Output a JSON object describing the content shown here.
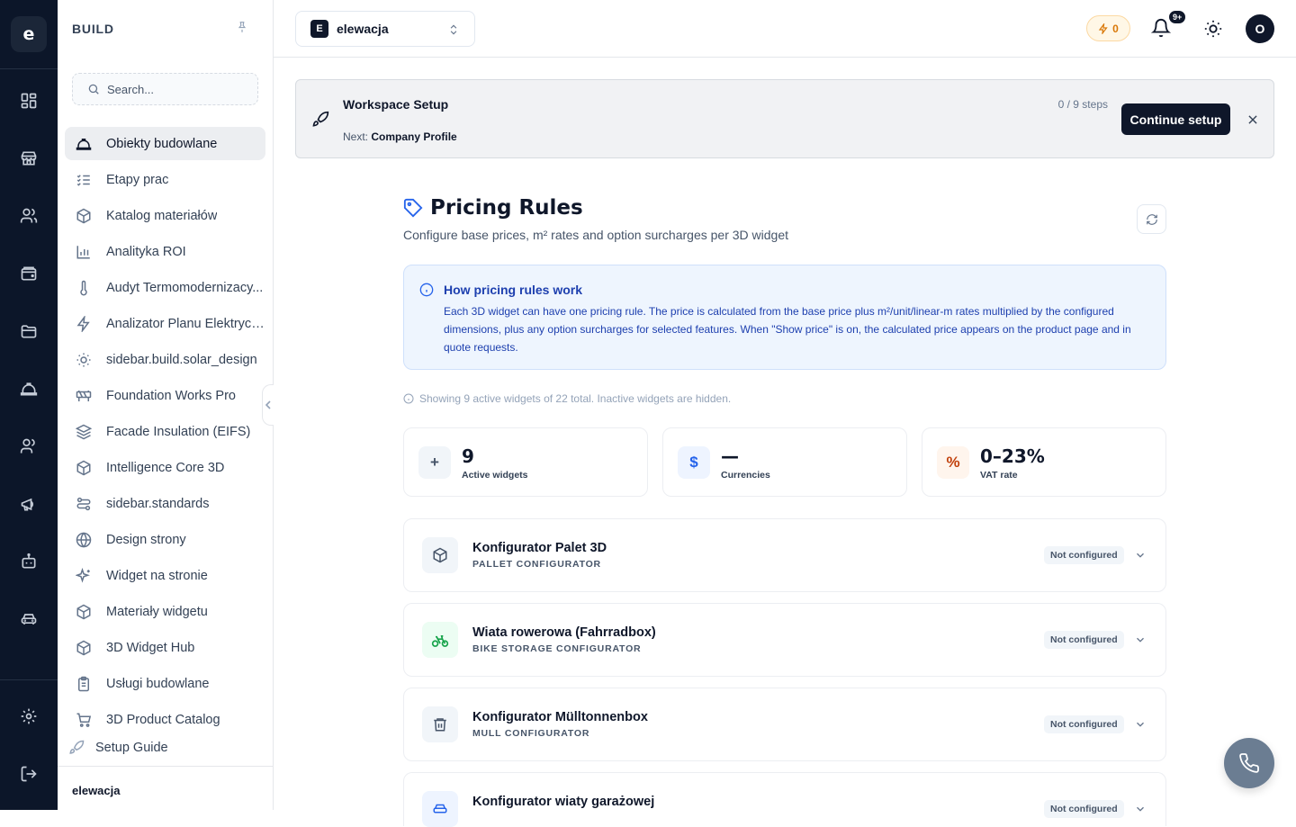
{
  "rail": {
    "logo_letter": "e",
    "icons": [
      "dashboard-icon",
      "store-icon",
      "users-icon",
      "wallet-icon",
      "folder-icon",
      "helmet-icon",
      "team-icon",
      "megaphone-icon",
      "robot-icon",
      "car-icon"
    ],
    "bottom_icons": [
      "settings-icon",
      "logout-icon"
    ]
  },
  "sidebar": {
    "section": "BUILD",
    "search_placeholder": "Search...",
    "items": [
      {
        "label": "Obiekty budowlane",
        "icon": "helmet-icon",
        "active": true
      },
      {
        "label": "Etapy prac",
        "icon": "checklist-icon"
      },
      {
        "label": "Katalog materiałów",
        "icon": "box-icon"
      },
      {
        "label": "Analityka ROI",
        "icon": "bar-chart-icon"
      },
      {
        "label": "Audyt Termomodernizacy...",
        "icon": "thermometer-icon"
      },
      {
        "label": "Analizator Planu Elektrycz...",
        "icon": "lightning-icon"
      },
      {
        "label": "sidebar.build.solar_design",
        "icon": "sun-icon"
      },
      {
        "label": "Foundation Works Pro",
        "icon": "barrier-icon"
      },
      {
        "label": "Facade Insulation (EIFS)",
        "icon": "layers-icon"
      },
      {
        "label": "Intelligence Core 3D",
        "icon": "box-icon"
      },
      {
        "label": "sidebar.standards",
        "icon": "route-icon"
      },
      {
        "label": "Design strony",
        "icon": "globe-icon"
      },
      {
        "label": "Widget na stronie",
        "icon": "sparkles-icon"
      },
      {
        "label": "Materiały widgetu",
        "icon": "box-icon"
      },
      {
        "label": "3D Widget Hub",
        "icon": "box-icon"
      },
      {
        "label": "Usługi budowlane",
        "icon": "clipboard-icon"
      },
      {
        "label": "3D Product Catalog",
        "icon": "cart-icon"
      }
    ],
    "setup_guide": "Setup Guide",
    "footer_workspace": "elewacja"
  },
  "topbar": {
    "workspace_letter": "E",
    "workspace_name": "elewacja",
    "credits": "0",
    "notifications_badge": "9+",
    "avatar_letter": "O"
  },
  "banner": {
    "title": "Workspace Setup",
    "next_label": "Next:",
    "next_value": "Company Profile",
    "steps": "0 / 9 steps",
    "button": "Continue setup"
  },
  "page": {
    "title": "Pricing Rules",
    "subtitle": "Configure base prices, m² rates and option surcharges per 3D widget",
    "info_title": "How pricing rules work",
    "info_body": "Each 3D widget can have one pricing rule. The price is calculated from the base price plus m²/unit/linear-m rates multiplied by the configured dimensions, plus any option surcharges for selected features. When \"Show price\" is on, the calculated price appears on the product page and in quote requests.",
    "note": "Showing 9 active widgets of 22 total. Inactive widgets are hidden."
  },
  "stats": [
    {
      "value": "9",
      "label": "Active widgets",
      "glyph": "+",
      "color": "#475569",
      "bg": "#f1f5f9"
    },
    {
      "value": "—",
      "label": "Currencies",
      "glyph": "$",
      "color": "#2563eb",
      "bg": "#eef4ff"
    },
    {
      "value": "0–23%",
      "label": "VAT rate",
      "glyph": "%",
      "color": "#c2410c",
      "bg": "#fff5ed"
    }
  ],
  "widgets": [
    {
      "name": "Konfigurator Palet 3D",
      "sub": "PALLET CONFIGURATOR",
      "status": "Not configured",
      "icon": "box-icon"
    },
    {
      "name": "Wiata rowerowa (Fahrradbox)",
      "sub": "BIKE STORAGE CONFIGURATOR",
      "status": "Not configured",
      "icon": "bike-icon"
    },
    {
      "name": "Konfigurator Mülltonnenbox",
      "sub": "MULL CONFIGURATOR",
      "status": "Not configured",
      "icon": "trash-icon"
    },
    {
      "name": "Konfigurator wiaty garażowej",
      "sub": "",
      "status": "Not configured",
      "icon": "car-icon"
    }
  ]
}
